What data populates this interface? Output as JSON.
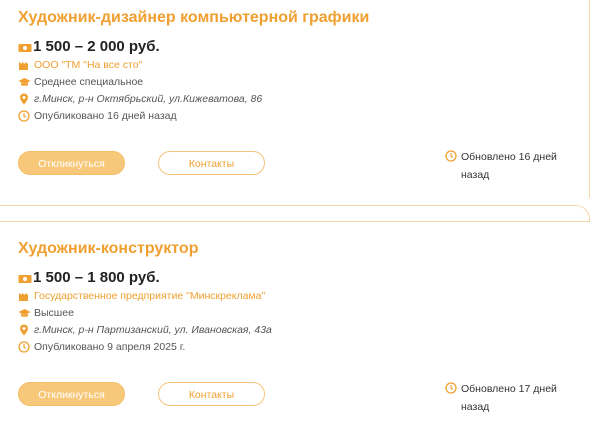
{
  "vacancies": [
    {
      "title": "Художник-дизайнер компьютерной графики",
      "salary": "1 500 – 2 000 руб.",
      "company": "ООО \"ТМ \"На все сто\"",
      "education": "Среднее специальное",
      "address": "г.Минск, р-н Октябрьский, ул.Кижеватова, 86",
      "published": "Опубликовано 16 дней назад",
      "apply_label": "Откликнуться",
      "contacts_label": "Контакты",
      "updated_line1": "Обновлено 16 дней",
      "updated_line2": "назад"
    },
    {
      "title": "Художник-конструктор",
      "salary": "1 500 – 1 800 руб.",
      "company": "Государственное предприятие \"Минскреклама\"",
      "education": "Высшее",
      "address": "г.Минск, р-н Партизанский, ул. Ивановская, 43а",
      "published": "Опубликовано 9 апреля 2025 г.",
      "apply_label": "Откликнуться",
      "contacts_label": "Контакты",
      "updated_line1": "Обновлено 17 дней",
      "updated_line2": "назад"
    }
  ],
  "icons": {
    "salary": "money-icon",
    "company": "building-icon",
    "education": "graduation-cap-icon",
    "address": "location-pin-icon",
    "published": "clock-icon",
    "updated": "clock-icon"
  },
  "colors": {
    "accent": "#f0a030",
    "button_fill": "#f8c87a",
    "divider": "#f3d7a8"
  }
}
